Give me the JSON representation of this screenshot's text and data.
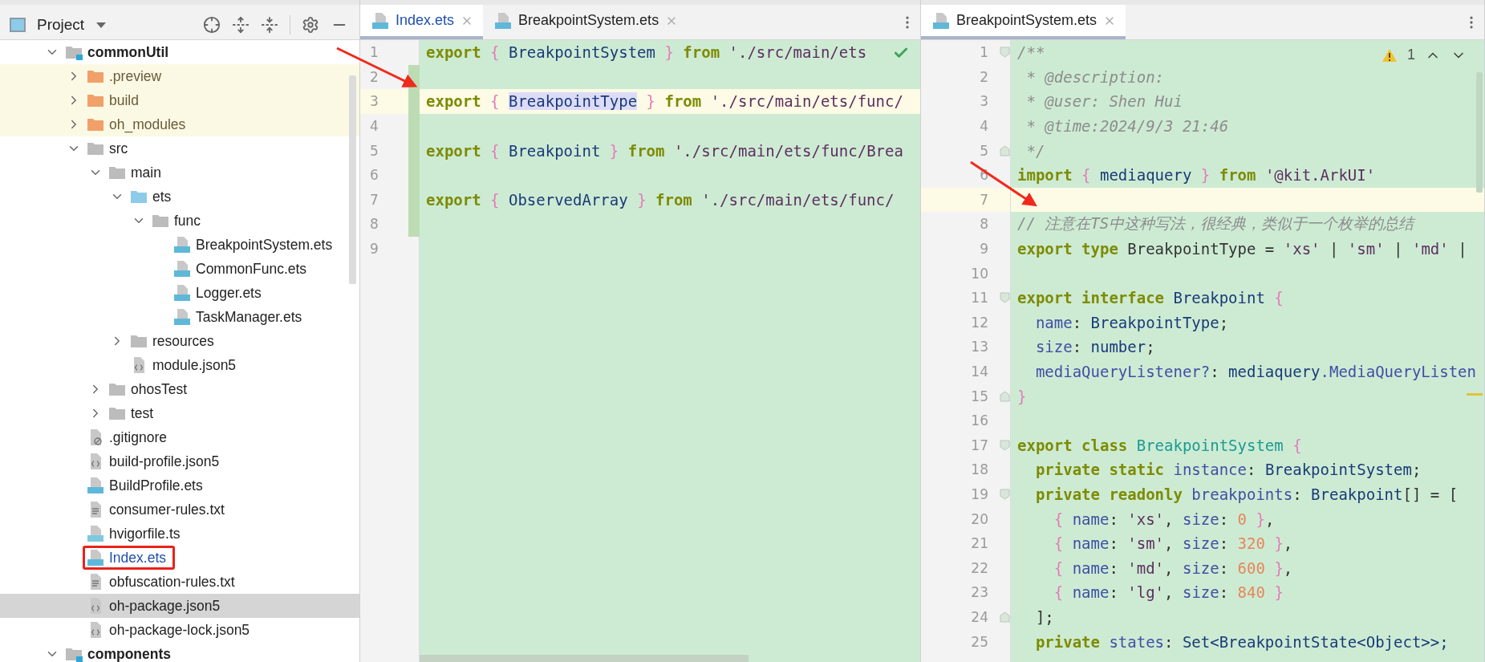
{
  "project_panel": {
    "title": "Project",
    "tree": [
      {
        "label": "commonUtil",
        "kind": "module",
        "expanded": true,
        "selected": false,
        "children": [
          {
            "label": ".preview",
            "kind": "excluded-folder",
            "expanded": false,
            "selected": false
          },
          {
            "label": "build",
            "kind": "excluded-folder",
            "expanded": false,
            "selected": false
          },
          {
            "label": "oh_modules",
            "kind": "excluded-folder",
            "expanded": false,
            "selected": false
          },
          {
            "label": "src",
            "kind": "folder",
            "expanded": true,
            "selected": false,
            "children": [
              {
                "label": "main",
                "kind": "folder",
                "expanded": true,
                "selected": false,
                "children": [
                  {
                    "label": "ets",
                    "kind": "source-folder",
                    "expanded": true,
                    "selected": false,
                    "children": [
                      {
                        "label": "func",
                        "kind": "folder",
                        "expanded": true,
                        "selected": false,
                        "children": [
                          {
                            "label": "BreakpointSystem.ets",
                            "kind": "ets",
                            "selected": false,
                            "modified": false,
                            "highlighted": false
                          },
                          {
                            "label": "CommonFunc.ets",
                            "kind": "ets",
                            "selected": false,
                            "modified": false,
                            "highlighted": false
                          },
                          {
                            "label": "Logger.ets",
                            "kind": "ets",
                            "selected": false,
                            "modified": false,
                            "highlighted": false
                          },
                          {
                            "label": "TaskManager.ets",
                            "kind": "ets",
                            "selected": false,
                            "modified": false,
                            "highlighted": false
                          }
                        ]
                      }
                    ]
                  },
                  {
                    "label": "resources",
                    "kind": "folder",
                    "expanded": false,
                    "selected": false
                  },
                  {
                    "label": "module.json5",
                    "kind": "json",
                    "selected": false,
                    "modified": false,
                    "highlighted": false
                  }
                ]
              },
              {
                "label": "ohosTest",
                "kind": "folder",
                "expanded": false,
                "selected": false
              },
              {
                "label": "test",
                "kind": "folder",
                "expanded": false,
                "selected": false
              }
            ]
          },
          {
            "label": ".gitignore",
            "kind": "ignore",
            "selected": false,
            "modified": false,
            "highlighted": false
          },
          {
            "label": "build-profile.json5",
            "kind": "json",
            "selected": false,
            "modified": false,
            "highlighted": false
          },
          {
            "label": "BuildProfile.ets",
            "kind": "ets",
            "selected": false,
            "modified": false,
            "highlighted": false
          },
          {
            "label": "consumer-rules.txt",
            "kind": "text",
            "selected": false,
            "modified": false,
            "highlighted": false
          },
          {
            "label": "hvigorfile.ts",
            "kind": "ts",
            "selected": false,
            "modified": false,
            "highlighted": false
          },
          {
            "label": "Index.ets",
            "kind": "ets",
            "selected": false,
            "modified": true,
            "highlighted": true
          },
          {
            "label": "obfuscation-rules.txt",
            "kind": "text",
            "selected": false,
            "modified": false,
            "highlighted": false
          },
          {
            "label": "oh-package.json5",
            "kind": "json",
            "selected": true,
            "modified": false,
            "highlighted": false
          },
          {
            "label": "oh-package-lock.json5",
            "kind": "json",
            "selected": false,
            "modified": false,
            "highlighted": false
          }
        ]
      },
      {
        "label": "components",
        "kind": "module",
        "expanded": true,
        "selected": false
      }
    ]
  },
  "editors": [
    {
      "tabs": [
        {
          "label": "Index.ets",
          "selected": true,
          "modified": true
        },
        {
          "label": "BreakpointSystem.ets",
          "selected": false,
          "modified": false
        }
      ],
      "inspection_ok": true,
      "lines": [
        {
          "number": "1",
          "current": false,
          "changed": false,
          "tokens": [
            {
              "text": "export",
              "kind": "kw"
            },
            {
              "text": " {",
              "kind": "br"
            },
            {
              "text": " BreakpointSystem ",
              "kind": "id"
            },
            {
              "text": "}",
              "kind": "br"
            },
            {
              "text": " from",
              "kind": "kw"
            },
            {
              "text": " './src/main/ets",
              "kind": "str"
            }
          ]
        },
        {
          "number": "2",
          "current": false,
          "changed": true
        },
        {
          "number": "3",
          "current": true,
          "changed": true,
          "tokens": [
            {
              "text": "export",
              "kind": "kw"
            },
            {
              "text": " { ",
              "kind": "br"
            },
            {
              "text": "BreakpointType",
              "kind": "ref"
            },
            {
              "text": " }",
              "kind": "br"
            },
            {
              "text": " from",
              "kind": "kw"
            },
            {
              "text": " './src/main/ets/func/",
              "kind": "str"
            }
          ]
        },
        {
          "number": "4",
          "current": false,
          "changed": true
        },
        {
          "number": "5",
          "current": false,
          "changed": true,
          "tokens": [
            {
              "text": "export",
              "kind": "kw"
            },
            {
              "text": " {",
              "kind": "br"
            },
            {
              "text": " Breakpoint ",
              "kind": "id"
            },
            {
              "text": "}",
              "kind": "br"
            },
            {
              "text": " from",
              "kind": "kw"
            },
            {
              "text": " './src/main/ets/func/Brea",
              "kind": "str"
            }
          ]
        },
        {
          "number": "6",
          "current": false,
          "changed": true
        },
        {
          "number": "7",
          "current": false,
          "changed": true,
          "tokens": [
            {
              "text": "export",
              "kind": "kw"
            },
            {
              "text": " {",
              "kind": "br"
            },
            {
              "text": " ObservedArray ",
              "kind": "id"
            },
            {
              "text": "}",
              "kind": "br"
            },
            {
              "text": " from",
              "kind": "kw"
            },
            {
              "text": " './src/main/ets/func/",
              "kind": "str"
            }
          ]
        },
        {
          "number": "8",
          "current": false,
          "changed": true
        },
        {
          "number": "9",
          "current": false,
          "changed": false
        }
      ]
    },
    {
      "tabs": [
        {
          "label": "BreakpointSystem.ets",
          "selected": true,
          "modified": false
        }
      ],
      "warnings": "1",
      "lines": [
        {
          "number": "1",
          "current": false,
          "fold_start": true,
          "fold_end": false,
          "tokens": [
            {
              "text": "/**",
              "kind": "cm"
            }
          ]
        },
        {
          "number": "2",
          "current": false,
          "fold_start": false,
          "fold_end": false,
          "tokens": [
            {
              "text": " * @description:",
              "kind": "cm"
            }
          ]
        },
        {
          "number": "3",
          "current": false,
          "fold_start": false,
          "fold_end": false,
          "tokens": [
            {
              "text": " * @user: Shen Hui",
              "kind": "cm"
            }
          ]
        },
        {
          "number": "4",
          "current": false,
          "fold_start": false,
          "fold_end": false,
          "tokens": [
            {
              "text": " * @time:2024/9/3 21:46",
              "kind": "cm"
            }
          ]
        },
        {
          "number": "5",
          "current": false,
          "fold_start": false,
          "fold_end": true,
          "tokens": [
            {
              "text": " */",
              "kind": "cm"
            }
          ]
        },
        {
          "number": "6",
          "current": false,
          "fold_start": false,
          "fold_end": false,
          "tokens": [
            {
              "text": "import",
              "kind": "kw"
            },
            {
              "text": " {",
              "kind": "br"
            },
            {
              "text": " mediaquery ",
              "kind": "id"
            },
            {
              "text": "}",
              "kind": "br"
            },
            {
              "text": " from",
              "kind": "kw"
            },
            {
              "text": " '@kit.ArkUI'",
              "kind": "str"
            }
          ]
        },
        {
          "number": "7",
          "current": true,
          "fold_start": false,
          "fold_end": false
        },
        {
          "number": "8",
          "current": false,
          "fold_start": false,
          "fold_end": false,
          "tokens": [
            {
              "text": "// 注意在TS中这种写法，很经典，类似于一个枚举的总结",
              "kind": "cm"
            }
          ]
        },
        {
          "number": "9",
          "current": false,
          "fold_start": false,
          "fold_end": false,
          "tokens": [
            {
              "text": "export type",
              "kind": "kw"
            },
            {
              "text": " BreakpointType = ",
              "kind": "pl"
            },
            {
              "text": "'xs'",
              "kind": "str"
            },
            {
              "text": " | ",
              "kind": "pl"
            },
            {
              "text": "'sm'",
              "kind": "str"
            },
            {
              "text": " | ",
              "kind": "pl"
            },
            {
              "text": "'md'",
              "kind": "str"
            },
            {
              "text": " |",
              "kind": "pl"
            }
          ]
        },
        {
          "number": "10",
          "current": false,
          "fold_start": false,
          "fold_end": false
        },
        {
          "number": "11",
          "current": false,
          "fold_start": true,
          "fold_end": false,
          "tokens": [
            {
              "text": "export interface",
              "kind": "kw"
            },
            {
              "text": " Breakpoint ",
              "kind": "id"
            },
            {
              "text": "{",
              "kind": "br"
            }
          ]
        },
        {
          "number": "12",
          "current": false,
          "fold_start": false,
          "fold_end": false,
          "tokens": [
            {
              "text": "  name",
              "kind": "prop"
            },
            {
              "text": ": ",
              "kind": "pl"
            },
            {
              "text": "BreakpointType",
              "kind": "id"
            },
            {
              "text": ";",
              "kind": "pl"
            }
          ]
        },
        {
          "number": "13",
          "current": false,
          "fold_start": false,
          "fold_end": false,
          "tokens": [
            {
              "text": "  size",
              "kind": "prop"
            },
            {
              "text": ": ",
              "kind": "pl"
            },
            {
              "text": "number",
              "kind": "id"
            },
            {
              "text": ";",
              "kind": "pl"
            }
          ]
        },
        {
          "number": "14",
          "current": false,
          "fold_start": false,
          "fold_end": false,
          "tokens": [
            {
              "text": "  mediaQueryListener?",
              "kind": "prop"
            },
            {
              "text": ": ",
              "kind": "pl"
            },
            {
              "text": "mediaquery",
              "kind": "id"
            },
            {
              "text": ".MediaQueryListen",
              "kind": "prop"
            }
          ]
        },
        {
          "number": "15",
          "current": false,
          "fold_start": false,
          "fold_end": true,
          "tokens": [
            {
              "text": "}",
              "kind": "br"
            }
          ]
        },
        {
          "number": "16",
          "current": false,
          "fold_start": false,
          "fold_end": false
        },
        {
          "number": "17",
          "current": false,
          "fold_start": true,
          "fold_end": false,
          "tokens": [
            {
              "text": "export class",
              "kind": "kw"
            },
            {
              "text": " BreakpointSystem",
              "kind": "cls"
            },
            {
              "text": " {",
              "kind": "br"
            }
          ]
        },
        {
          "number": "18",
          "current": false,
          "fold_start": false,
          "fold_end": false,
          "tokens": [
            {
              "text": "  private static",
              "kind": "kw"
            },
            {
              "text": " instance",
              "kind": "prop"
            },
            {
              "text": ": ",
              "kind": "pl"
            },
            {
              "text": "BreakpointSystem",
              "kind": "id"
            },
            {
              "text": ";",
              "kind": "pl"
            }
          ]
        },
        {
          "number": "19",
          "current": false,
          "fold_start": true,
          "fold_end": false,
          "tokens": [
            {
              "text": "  private readonly",
              "kind": "kw"
            },
            {
              "text": " breakpoints",
              "kind": "prop"
            },
            {
              "text": ": ",
              "kind": "pl"
            },
            {
              "text": "Breakpoint",
              "kind": "id"
            },
            {
              "text": "[] = [",
              "kind": "pl"
            }
          ]
        },
        {
          "number": "20",
          "current": false,
          "fold_start": false,
          "fold_end": false,
          "tokens": [
            {
              "text": "    {",
              "kind": "br"
            },
            {
              "text": " name",
              "kind": "prop"
            },
            {
              "text": ": ",
              "kind": "pl"
            },
            {
              "text": "'xs'",
              "kind": "str"
            },
            {
              "text": ", ",
              "kind": "pl"
            },
            {
              "text": "size",
              "kind": "prop"
            },
            {
              "text": ": ",
              "kind": "pl"
            },
            {
              "text": "0",
              "kind": "num"
            },
            {
              "text": " }",
              "kind": "br"
            },
            {
              "text": ",",
              "kind": "pl"
            }
          ]
        },
        {
          "number": "21",
          "current": false,
          "fold_start": false,
          "fold_end": false,
          "tokens": [
            {
              "text": "    {",
              "kind": "br"
            },
            {
              "text": " name",
              "kind": "prop"
            },
            {
              "text": ": ",
              "kind": "pl"
            },
            {
              "text": "'sm'",
              "kind": "str"
            },
            {
              "text": ", ",
              "kind": "pl"
            },
            {
              "text": "size",
              "kind": "prop"
            },
            {
              "text": ": ",
              "kind": "pl"
            },
            {
              "text": "320",
              "kind": "num"
            },
            {
              "text": " }",
              "kind": "br"
            },
            {
              "text": ",",
              "kind": "pl"
            }
          ]
        },
        {
          "number": "22",
          "current": false,
          "fold_start": false,
          "fold_end": false,
          "tokens": [
            {
              "text": "    {",
              "kind": "br"
            },
            {
              "text": " name",
              "kind": "prop"
            },
            {
              "text": ": ",
              "kind": "pl"
            },
            {
              "text": "'md'",
              "kind": "str"
            },
            {
              "text": ", ",
              "kind": "pl"
            },
            {
              "text": "size",
              "kind": "prop"
            },
            {
              "text": ": ",
              "kind": "pl"
            },
            {
              "text": "600",
              "kind": "num"
            },
            {
              "text": " }",
              "kind": "br"
            },
            {
              "text": ",",
              "kind": "pl"
            }
          ]
        },
        {
          "number": "23",
          "current": false,
          "fold_start": false,
          "fold_end": false,
          "tokens": [
            {
              "text": "    {",
              "kind": "br"
            },
            {
              "text": " name",
              "kind": "prop"
            },
            {
              "text": ": ",
              "kind": "pl"
            },
            {
              "text": "'lg'",
              "kind": "str"
            },
            {
              "text": ", ",
              "kind": "pl"
            },
            {
              "text": "size",
              "kind": "prop"
            },
            {
              "text": ": ",
              "kind": "pl"
            },
            {
              "text": "840",
              "kind": "num"
            },
            {
              "text": " }",
              "kind": "br"
            }
          ]
        },
        {
          "number": "24",
          "current": false,
          "fold_start": false,
          "fold_end": true,
          "tokens": [
            {
              "text": "  ];",
              "kind": "pl"
            }
          ]
        },
        {
          "number": "25",
          "current": false,
          "fold_start": false,
          "fold_end": false,
          "tokens": [
            {
              "text": "  private",
              "kind": "kw"
            },
            {
              "text": " states",
              "kind": "prop"
            },
            {
              "text": ": ",
              "kind": "pl"
            },
            {
              "text": "Set<BreakpointState<Object>>;",
              "kind": "id"
            }
          ]
        }
      ]
    }
  ]
}
